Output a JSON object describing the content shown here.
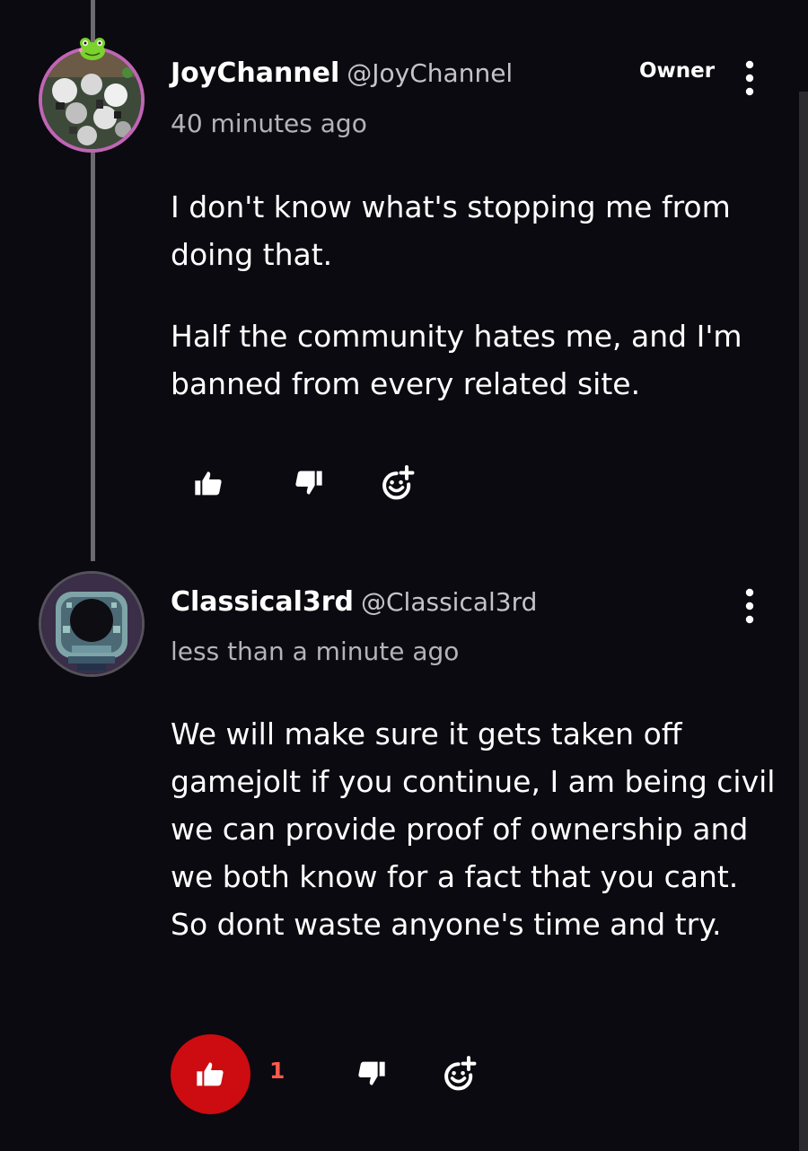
{
  "colors": {
    "background": "#0b0a10",
    "text": "#ffffff",
    "muted_text": "#b4b4b8",
    "thread_line": "#6a6a70",
    "avatar_ring_owner": "#c065b4",
    "liked_button": "#cc0c10",
    "like_count": "#ff5a4e"
  },
  "comments": [
    {
      "username": "JoyChannel",
      "handle": "@JoyChannel",
      "timestamp": "40 minutes ago",
      "badge": "Owner",
      "paragraphs": [
        "I don't know what's stopping me from doing that.",
        "Half the community hates me, and I'm banned from every related site."
      ],
      "liked": false,
      "icons": [
        "more-vertical-icon",
        "thumbs-up-icon",
        "thumbs-down-icon",
        "add-reaction-icon"
      ]
    },
    {
      "username": "Classical3rd",
      "handle": "@Classical3rd",
      "timestamp": "less than a minute ago",
      "paragraphs": [
        "We will make sure it gets taken off gamejolt if you continue, I am being civil we can provide proof of ownership and we both know for a fact that you cant. So dont waste anyone's time and try."
      ],
      "liked": true,
      "like_count": "1",
      "icons": [
        "more-vertical-icon",
        "thumbs-up-icon",
        "thumbs-down-icon",
        "add-reaction-icon"
      ]
    }
  ]
}
